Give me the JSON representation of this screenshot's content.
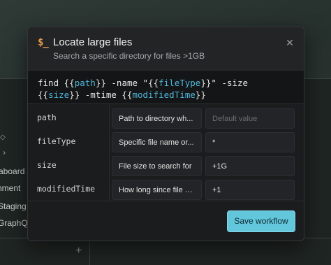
{
  "background": {
    "sidebar_items": [
      "aboard",
      "nment",
      "Staging",
      "GraphQ"
    ],
    "chevron": "›",
    "plus": "+"
  },
  "dialog": {
    "icon": "$_",
    "title": "Locate large files",
    "subtitle": "Search a specific directory for files >1GB",
    "close": "✕",
    "command": {
      "line1_a": "find ",
      "line1_b": "{{",
      "line1_var1": "path",
      "line1_c": "}} -name \"{{",
      "line1_var2": "fileType",
      "line1_d": "}}\" -size",
      "line2_a": "{{",
      "line2_var3": "size",
      "line2_b": "}} -mtime {{",
      "line2_var4": "modifiedTime",
      "line2_c": "}}"
    },
    "params": [
      {
        "name": "path",
        "description": "Path to directory wh...",
        "default": "",
        "default_placeholder": "Default value"
      },
      {
        "name": "fileType",
        "description": "Specific file name or...",
        "default": "*",
        "default_placeholder": ""
      },
      {
        "name": "size",
        "description": "File size to search for",
        "default": "+1G",
        "default_placeholder": ""
      },
      {
        "name": "modifiedTime",
        "description": "How long since file h...",
        "default": "+1",
        "default_placeholder": ""
      }
    ],
    "save_label": "Save workflow"
  },
  "colors": {
    "accent": "#63c7dc",
    "variable": "#4fb6d9",
    "icon": "#e79a4b"
  }
}
